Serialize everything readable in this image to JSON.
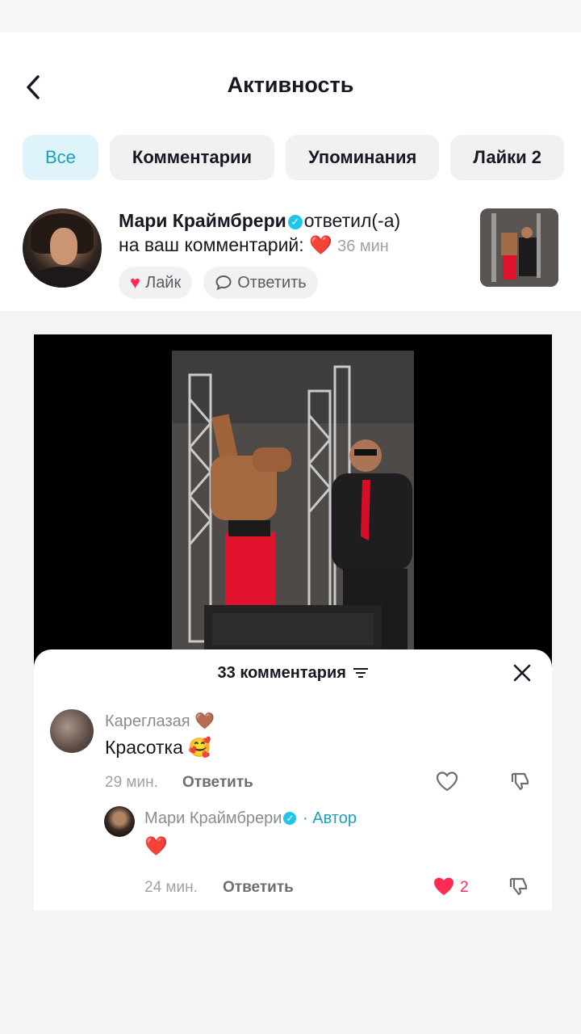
{
  "header": {
    "title": "Активность"
  },
  "tabs": [
    {
      "label": "Все",
      "active": true
    },
    {
      "label": "Комментарии"
    },
    {
      "label": "Упоминания"
    },
    {
      "label": "Лайки 2"
    }
  ],
  "notification": {
    "user": "Мари Краймбрери",
    "action": "ответил(-а)",
    "line2": "на ваш комментарий:",
    "emoji": "❤️",
    "time": "36 мин",
    "like_label": "Лайк",
    "reply_label": "Ответить"
  },
  "comments_panel": {
    "title": "33 комментария",
    "comments": [
      {
        "user": "Кареглазая",
        "user_emoji": "🤎",
        "text": "Красотка",
        "text_emoji": "🥰",
        "time": "29 мин.",
        "reply_label": "Ответить"
      },
      {
        "user": "Мари Краймбрери",
        "separator": "·",
        "badge": "Автор",
        "text_emoji": "❤️",
        "time": "24 мин.",
        "reply_label": "Ответить",
        "likes": "2"
      }
    ]
  },
  "colors": {
    "accent": "#1ba0bd",
    "like": "#fe2c55",
    "verified": "#20c5ea"
  }
}
